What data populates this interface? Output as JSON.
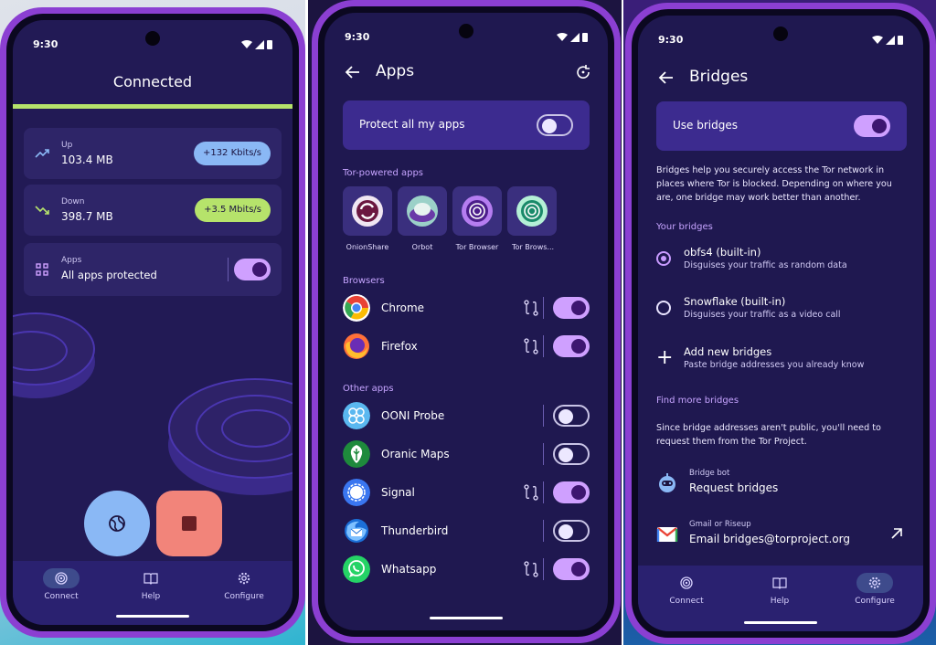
{
  "status": {
    "time": "9:30"
  },
  "screen1": {
    "title": "Connected",
    "up": {
      "label": "Up",
      "value": "103.4 MB",
      "rate": "+132 Kbits/s"
    },
    "down": {
      "label": "Down",
      "value": "398.7 MB",
      "rate": "+3.5 Mbits/s"
    },
    "apps": {
      "label": "Apps",
      "value": "All apps protected",
      "toggle_on": true
    }
  },
  "nav": {
    "connect": "Connect",
    "help": "Help",
    "configure": "Configure"
  },
  "screen2": {
    "title": "Apps",
    "protect_all": "Protect all my apps",
    "protect_all_on": false,
    "tor_section": "Tor-powered apps",
    "tor_apps": [
      "OnionShare",
      "Orbot",
      "Tor Browser",
      "Tor Brows..."
    ],
    "browsers_section": "Browsers",
    "browsers": [
      {
        "name": "Chrome",
        "on": true
      },
      {
        "name": "Firefox",
        "on": true
      }
    ],
    "other_section": "Other apps",
    "other": [
      {
        "name": "OONI Probe",
        "on": false
      },
      {
        "name": "Oranic Maps",
        "on": false
      },
      {
        "name": "Signal",
        "on": true
      },
      {
        "name": "Thunderbird",
        "on": false
      },
      {
        "name": "Whatsapp",
        "on": true
      }
    ]
  },
  "screen3": {
    "title": "Bridges",
    "use_bridges": "Use bridges",
    "use_bridges_on": true,
    "intro": "Bridges help you securely access the Tor network in places where Tor is blocked. Depending on where you are, one bridge may work better than another.",
    "your_bridges": "Your bridges",
    "options": [
      {
        "title": "obfs4 (built-in)",
        "subtitle": "Disguises your traffic as random data",
        "selected": true
      },
      {
        "title": "Snowflake (built-in)",
        "subtitle": "Disguises your traffic as a video call",
        "selected": false
      }
    ],
    "add": {
      "title": "Add new bridges",
      "subtitle": "Paste bridge addresses you already know"
    },
    "find_more": "Find more bridges",
    "find_desc": "Since bridge addresses aren't public, you'll need to request them from the Tor Project.",
    "bridge_bot": {
      "label": "Bridge bot",
      "value": "Request bridges"
    },
    "email": {
      "label": "Gmail or Riseup",
      "value": "Email bridges@torproject.org"
    }
  },
  "colors": {
    "accent_purple": "#cfa0ff",
    "up_pill": "#8ab8f5",
    "down_pill": "#b6e36b",
    "connected_bar": "#b6e36b",
    "stop_button": "#f2847a"
  }
}
